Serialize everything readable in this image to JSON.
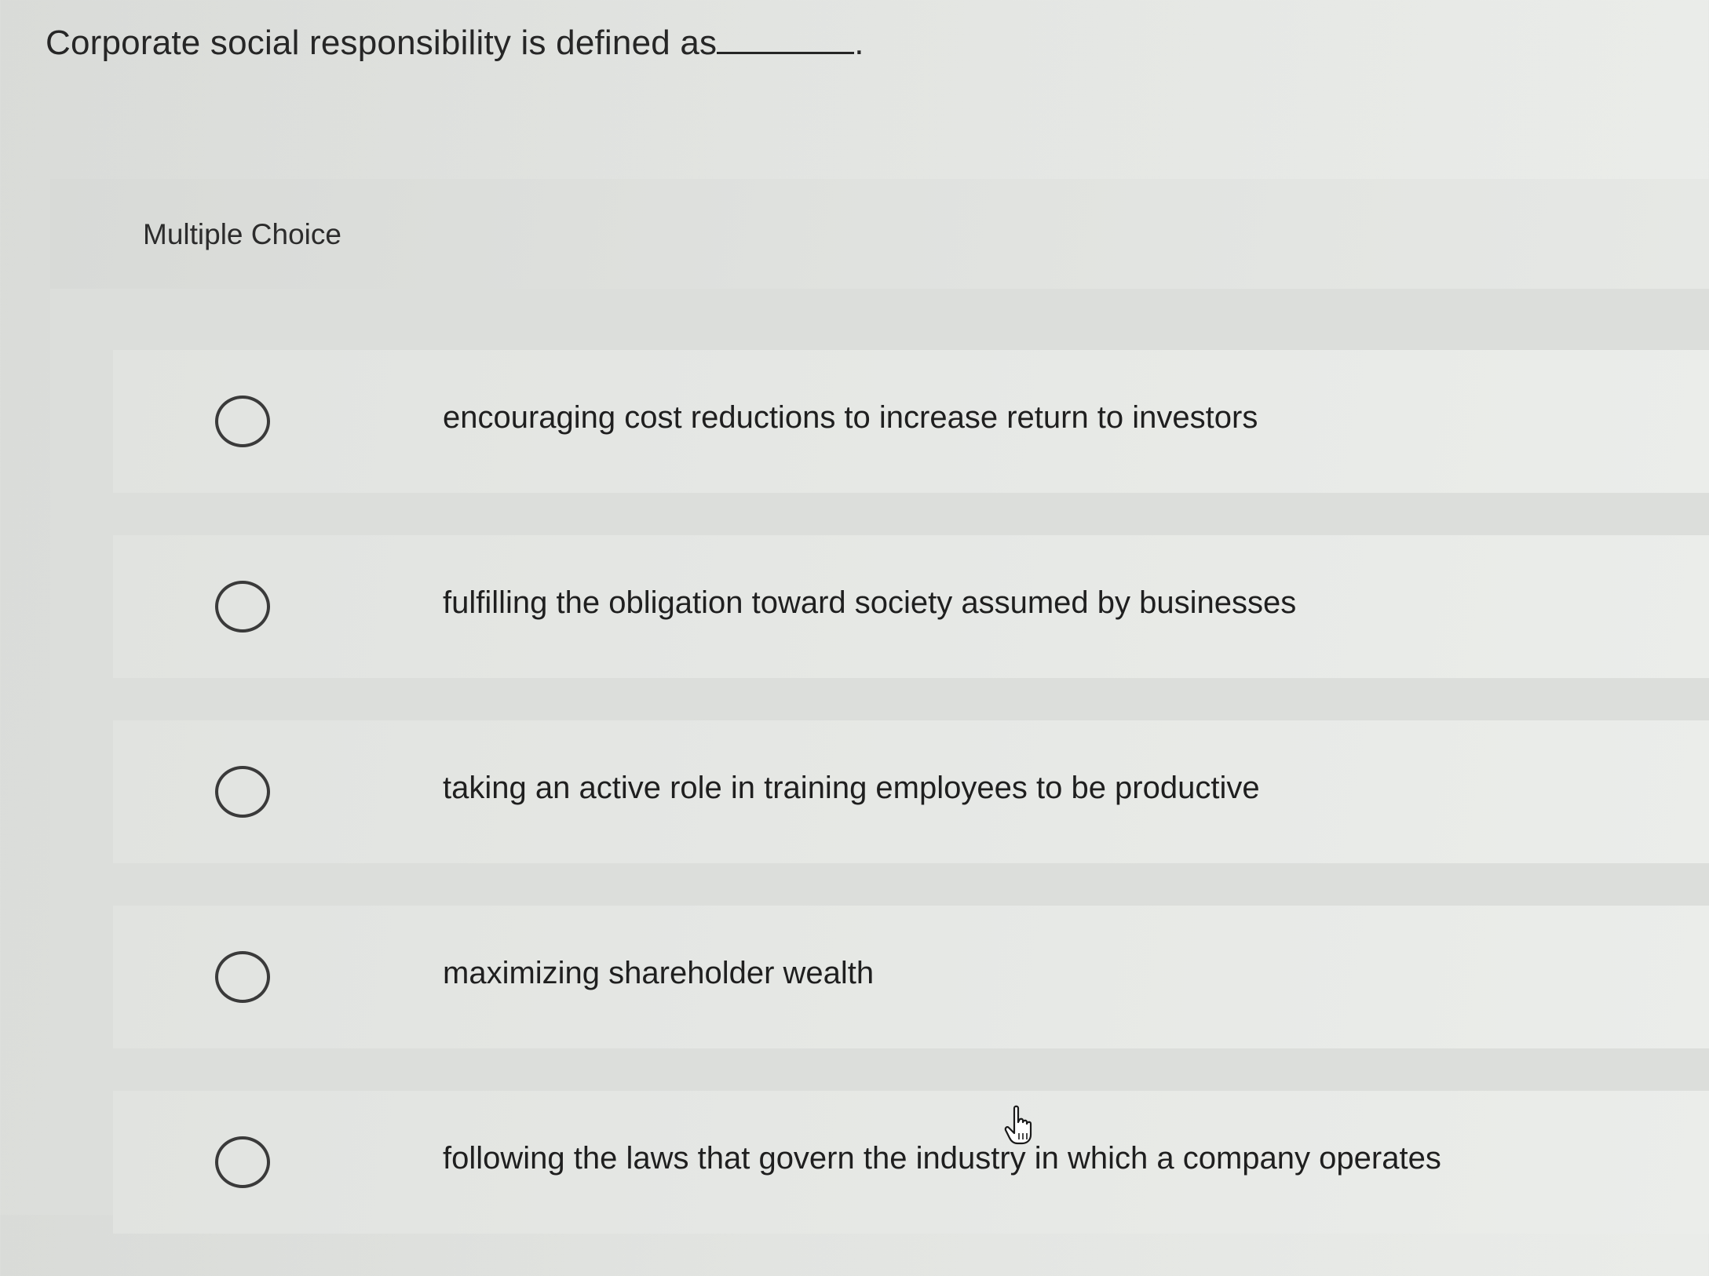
{
  "question": {
    "text": "Corporate social responsibility is defined as",
    "end_punct": "."
  },
  "panel": {
    "title": "Multiple Choice"
  },
  "choices": [
    {
      "label": "encouraging cost reductions to increase return to investors"
    },
    {
      "label": "fulfilling the obligation toward society assumed by businesses"
    },
    {
      "label": "taking an active role in training employees to be productive"
    },
    {
      "label": "maximizing shareholder wealth"
    },
    {
      "label": "following the laws that govern the industry in which a company operates"
    }
  ],
  "icons": {
    "radio": "radio-circle-icon",
    "cursor": "hand-pointer-icon"
  }
}
